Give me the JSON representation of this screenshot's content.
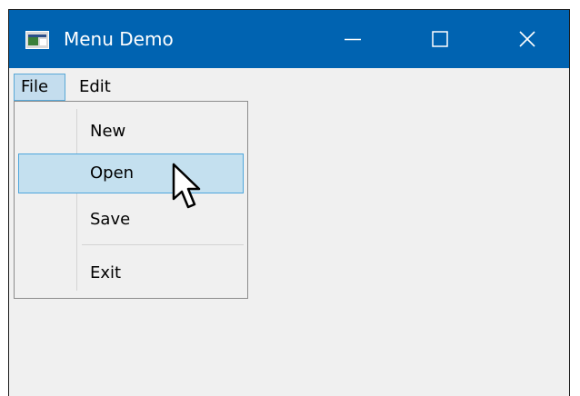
{
  "window": {
    "title": "Menu Demo",
    "accent_color": "#0063b1",
    "icons": {
      "app": "app-window-icon",
      "minimize": "minimize-icon",
      "maximize": "maximize-icon",
      "close": "close-icon"
    }
  },
  "menubar": {
    "items": [
      {
        "label": "File",
        "state": "open"
      },
      {
        "label": "Edit",
        "state": "normal"
      }
    ]
  },
  "file_menu": {
    "items": [
      {
        "label": "New"
      },
      {
        "label": "Open",
        "state": "hover"
      },
      {
        "label": "Save"
      },
      {
        "label": "Exit"
      }
    ],
    "highlight_color": "#c4e0ef"
  },
  "pointer": {
    "icon": "mouse-pointer-icon"
  }
}
